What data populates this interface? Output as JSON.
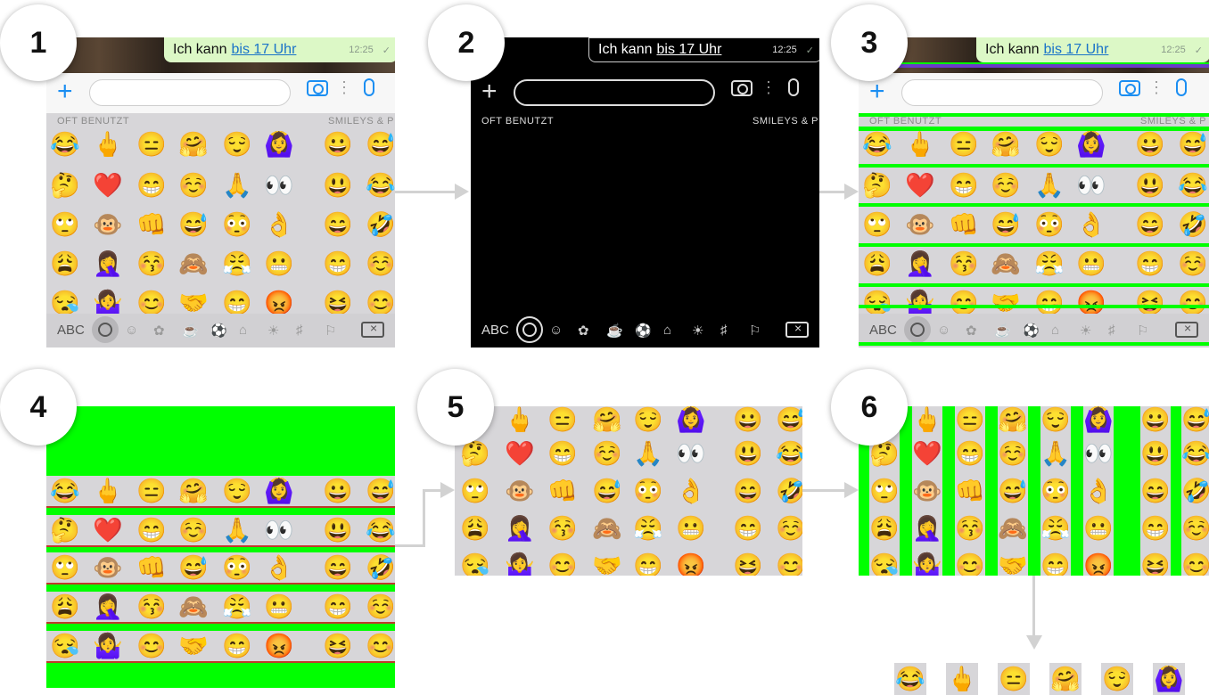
{
  "steps": [
    "1",
    "2",
    "3",
    "4",
    "5",
    "6"
  ],
  "chat": {
    "message_prefix": "Ich kann",
    "message_link": "bis 17 Uhr",
    "time": "12:25"
  },
  "keyboard": {
    "plus_glyph": "+",
    "more_glyph": "⋮",
    "category_frequent": "OFT BENUTZT",
    "category_smileys": "SMILEYS & P",
    "abc_label": "ABC",
    "category_icons": [
      "☺",
      "ὃb",
      "☕",
      "⚽",
      "Ἶ2",
      "Ὂ1",
      "♯",
      "⚐"
    ],
    "emoji_rows": [
      [
        "😂",
        "🖕",
        "😑",
        "🤗",
        "😌",
        "🙆‍♀️",
        "😀",
        "😅"
      ],
      [
        "🤔",
        "❤️",
        "😁",
        "☺️",
        "🙏",
        "👀",
        "😃",
        "😂"
      ],
      [
        "🙄",
        "🐵",
        "👊",
        "😅",
        "😳",
        "👌",
        "😄",
        "🤣"
      ],
      [
        "😩",
        "🤦‍♀️",
        "😚",
        "🙈",
        "😤",
        "😬",
        "😁",
        "☺️"
      ],
      [
        "😪",
        "🤷‍♀️",
        "😊",
        "🤝",
        "😁",
        "😡",
        "😆",
        "😊"
      ]
    ]
  },
  "highlight_color": "#00ff00",
  "arrow_color": "#d2d2d2"
}
